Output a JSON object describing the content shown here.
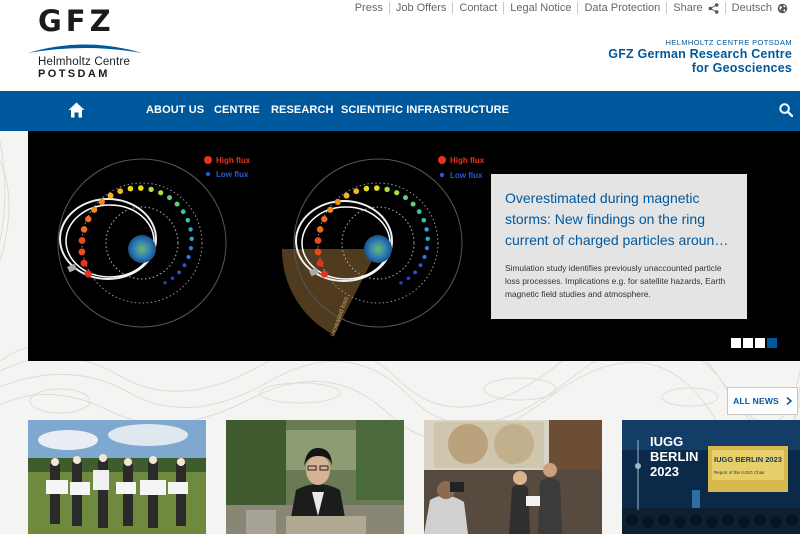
{
  "header": {
    "logo": {
      "wordmark": "GFZ",
      "line1": "Helmholtz Centre",
      "line2": "POTSDAM"
    },
    "institute": {
      "small": "Helmholtz Centre Potsdam",
      "line1": "GFZ German Research Centre",
      "line2": "for Geosciences"
    },
    "topnav": [
      "Press",
      "Job Offers",
      "Contact",
      "Legal Notice",
      "Data Protection"
    ],
    "share_label": "Share",
    "language_label": "Deutsch"
  },
  "mainnav": {
    "items": [
      "ABOUT US",
      "CENTRE",
      "RESEARCH",
      "SCIENTIFIC INFRASTRUCTURE"
    ]
  },
  "slider": {
    "legend": {
      "high": "High flux",
      "low": "Low flux"
    },
    "arc_label": "Increased loss",
    "caption_title": "Overestimated during magnetic storms: New findings on the ring current of charged particles aroun…",
    "caption_text": "Simulation study identifies previously unaccounted particle loss processes. Implications e.g. for satellite hazards, Earth magnetic field studies and atmosphere.",
    "dot_count": 4,
    "active_dot": 4
  },
  "allnews_label": "ALL NEWS",
  "cards": {
    "card4_text": {
      "line1": "IUGG",
      "line2": "BERLIN",
      "line3": "2023",
      "screen_title": "IUGG BERLIN 2023",
      "screen_sub": "Report of the IUGG Chair"
    }
  },
  "colors": {
    "brand_blue": "#00589c",
    "high_flux": "#e8321f",
    "low_flux": "#2b57d6"
  }
}
